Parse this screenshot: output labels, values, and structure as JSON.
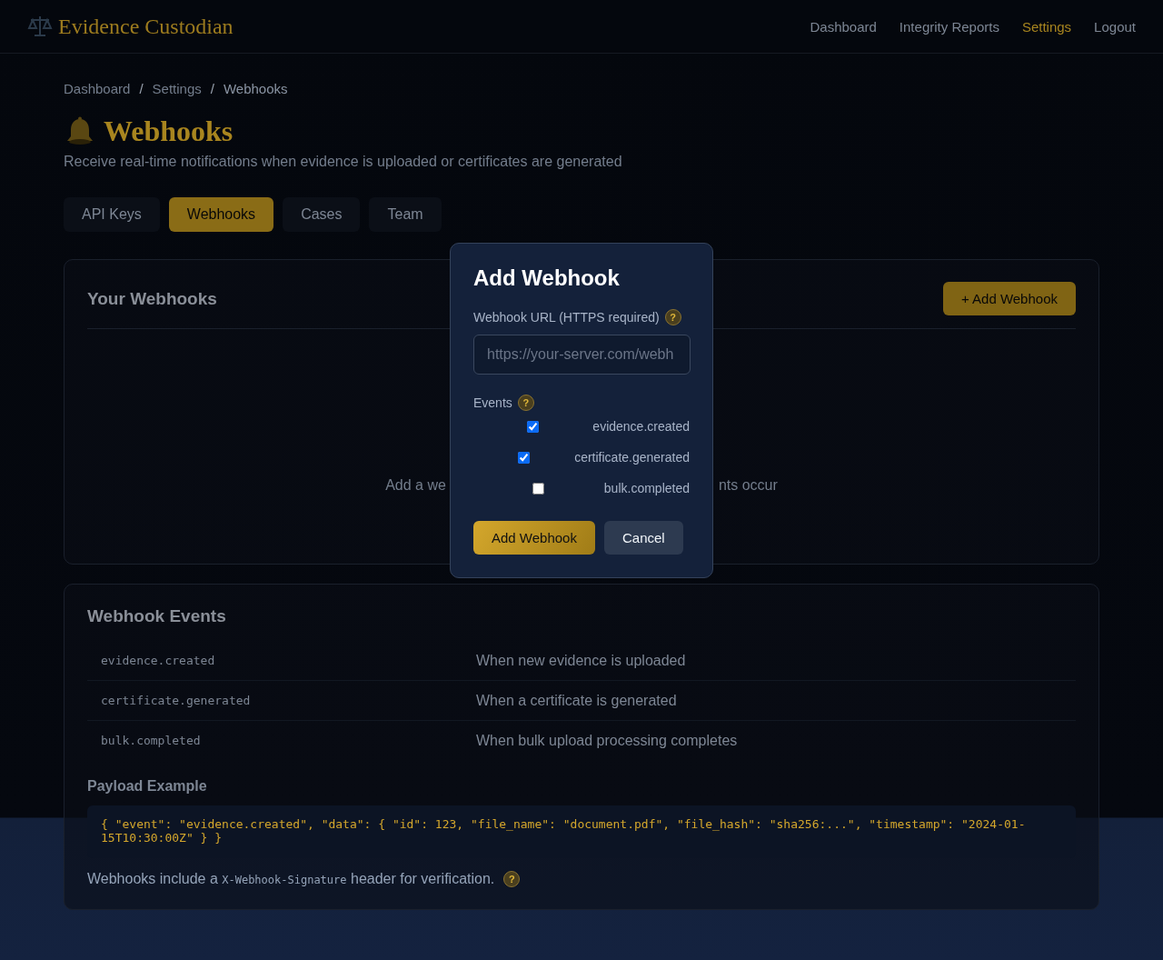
{
  "header": {
    "brand": "Evidence Custodian",
    "nav": [
      {
        "label": "Dashboard",
        "selected": false
      },
      {
        "label": "Integrity Reports",
        "selected": false
      },
      {
        "label": "Settings",
        "selected": true
      },
      {
        "label": "Logout",
        "selected": false
      }
    ]
  },
  "breadcrumb": [
    "Dashboard",
    "Settings",
    "Webhooks"
  ],
  "breadcrumb_separator": "/",
  "page": {
    "title": "Webhooks",
    "subtitle": "Receive real-time notifications when evidence is uploaded or certificates are generated"
  },
  "tabs": [
    {
      "label": "API Keys",
      "selected": false
    },
    {
      "label": "Webhooks",
      "selected": true
    },
    {
      "label": "Cases",
      "selected": false
    },
    {
      "label": "Team",
      "selected": false
    }
  ],
  "webhooks_card": {
    "title": "Your Webhooks",
    "add_button": "+ Add Webhook",
    "empty_state_left": "Add a we",
    "empty_state_right": "nts occur"
  },
  "events_card": {
    "title": "Webhook Events",
    "rows": [
      {
        "event": "evidence.created",
        "description": "When new evidence is uploaded"
      },
      {
        "event": "certificate.generated",
        "description": "When a certificate is generated"
      },
      {
        "event": "bulk.completed",
        "description": "When bulk upload processing completes"
      }
    ],
    "payload_title": "Payload Example",
    "payload": "{ \"event\": \"evidence.created\", \"data\": { \"id\": 123, \"file_name\": \"document.pdf\", \"file_hash\": \"sha256:...\", \"timestamp\": \"2024-01-15T10:30:00Z\" } }",
    "note_before": "Webhooks include a ",
    "note_code": "X-Webhook-Signature",
    "note_after": " header for verification.",
    "note_help": "?"
  },
  "modal": {
    "title": "Add Webhook",
    "url_label": "Webhook URL (HTTPS required)",
    "url_help": "?",
    "url_placeholder": "https://your-server.com/webh",
    "events_label": "Events",
    "events_help": "?",
    "events": [
      {
        "label": "evidence.created",
        "checked": true
      },
      {
        "label": "certificate.generated",
        "checked": true
      },
      {
        "label": "bulk.completed",
        "checked": false
      }
    ],
    "submit": "Add Webhook",
    "cancel": "Cancel"
  }
}
